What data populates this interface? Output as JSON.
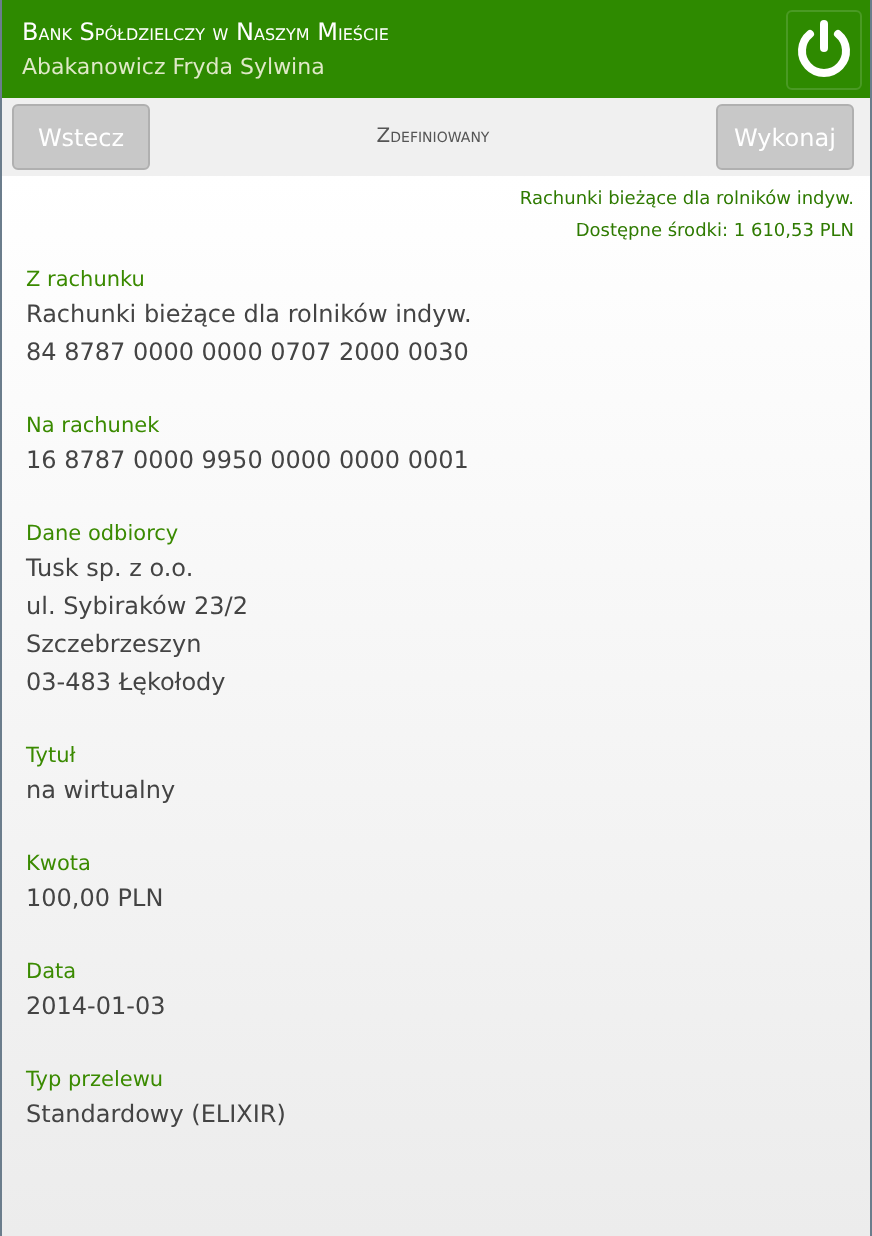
{
  "header": {
    "bank_name": "Bank Spółdzielczy w Naszym Mieście",
    "user_name": "Abakanowicz Fryda Sylwina"
  },
  "toolbar": {
    "back_button": "Wstecz",
    "title": "Zdefiniowany",
    "execute_button": "Wykonaj"
  },
  "account_info": [
    "Rachunki bieżące dla rolników indyw.",
    "Dostępne środki: 1 610,53 PLN"
  ],
  "fields": [
    {
      "label": "Z rachunku",
      "values": [
        "Rachunki bieżące dla rolników indyw.",
        "84 8787 0000 0000 0707 2000 0030"
      ]
    },
    {
      "label": "Na rachunek",
      "values": [
        "16 8787 0000 9950 0000 0000 0001"
      ]
    },
    {
      "label": "Dane odbiorcy",
      "values": [
        "Tusk sp. z o.o.",
        "ul. Sybiraków 23/2",
        "Szczebrzeszyn",
        "03-483 Łękołody"
      ]
    },
    {
      "label": "Tytuł",
      "values": [
        "na wirtualny"
      ]
    },
    {
      "label": "Kwota",
      "values": [
        "100,00 PLN"
      ]
    },
    {
      "label": "Data",
      "values": [
        "2014-01-03"
      ]
    },
    {
      "label": "Typ przelewu",
      "values": [
        "Standardowy (ELIXIR)"
      ]
    }
  ]
}
